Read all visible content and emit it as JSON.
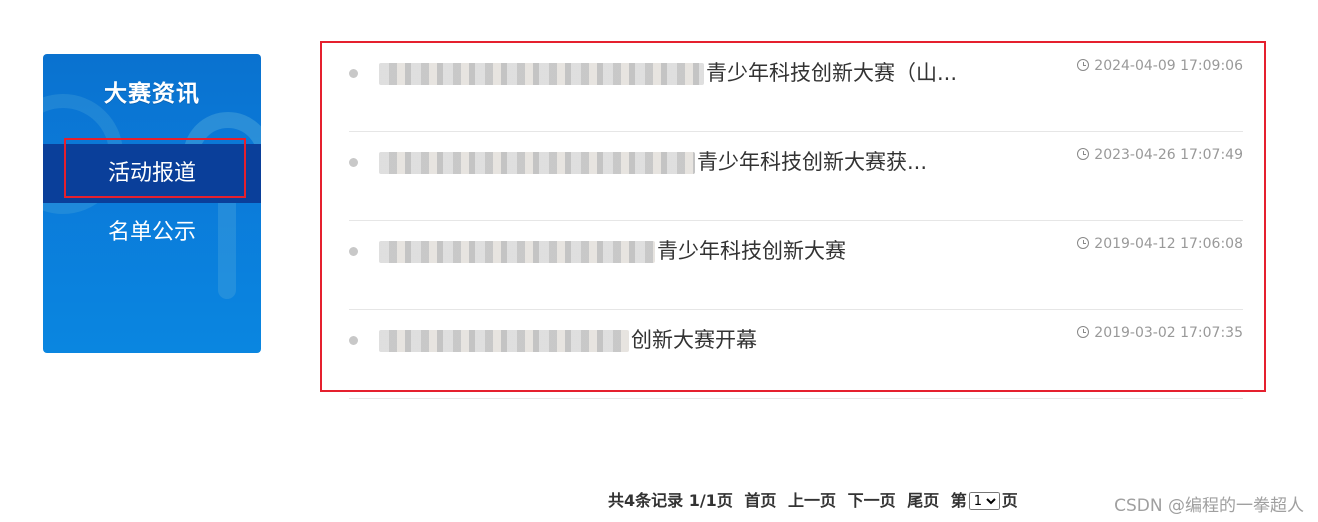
{
  "sidebar": {
    "title": "大赛资讯",
    "items": [
      {
        "label": "活动报道",
        "active": true
      },
      {
        "label": "名单公示",
        "active": false
      }
    ],
    "bg_color": "#0a7ad9",
    "active_color": "#0a3f9a",
    "highlight_color": "#e5202e"
  },
  "news": [
    {
      "title_visible": "青少年科技创新大赛（山...",
      "time": "2024-04-09 17:09:06"
    },
    {
      "title_visible": "青少年科技创新大赛获...",
      "time": "2023-04-26 17:07:49"
    },
    {
      "title_visible": "青少年科技创新大赛",
      "time": "2019-04-12 17:06:08"
    },
    {
      "title_visible": "创新大赛开幕",
      "time": "2019-03-02 17:07:35"
    }
  ],
  "pagination": {
    "summary": "共4条记录 1/1页",
    "first": "首页",
    "prev": "上一页",
    "next": "下一页",
    "last": "尾页",
    "page_prefix": "第",
    "page_suffix": "页",
    "page_value": "1"
  },
  "watermark": "CSDN @编程的一拳超人"
}
